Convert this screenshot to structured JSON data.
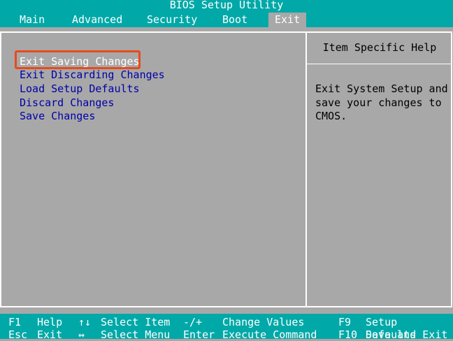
{
  "window": {
    "title": "BIOS Setup Utility"
  },
  "menu": {
    "tabs": [
      {
        "label": "Main"
      },
      {
        "label": "Advanced"
      },
      {
        "label": "Security"
      },
      {
        "label": "Boot"
      },
      {
        "label": "Exit"
      }
    ],
    "active_tab": "Exit"
  },
  "options": [
    {
      "label": "Exit Saving Changes"
    },
    {
      "label": "Exit Discarding Changes"
    },
    {
      "label": "Load Setup Defaults"
    },
    {
      "label": "Discard Changes"
    },
    {
      "label": "Save Changes"
    }
  ],
  "selected_option": "Exit Saving Changes",
  "help": {
    "title": "Item Specific Help",
    "lines": [
      "Exit System Setup and",
      "save your changes to",
      "CMOS."
    ]
  },
  "footer": {
    "row1": [
      {
        "key": "F1",
        "label": "Help"
      },
      {
        "key": "↑↓",
        "label": "Select Item"
      },
      {
        "key": "-/+",
        "label": "Change Values"
      },
      {
        "key": "F9",
        "label": "Setup Defaults"
      }
    ],
    "row2": [
      {
        "key": "Esc",
        "label": "Exit"
      },
      {
        "key": "↔",
        "label": "Select Menu"
      },
      {
        "key": "Enter",
        "label": "Execute Command"
      },
      {
        "key": "F10",
        "label": "Save and Exit"
      }
    ]
  },
  "colors": {
    "cyan": "#00a8a8",
    "gray": "#a8a8a8",
    "option_blue": "#0000a8",
    "highlight_orange": "#e84a1c",
    "key_yellow": "#ffff54"
  }
}
